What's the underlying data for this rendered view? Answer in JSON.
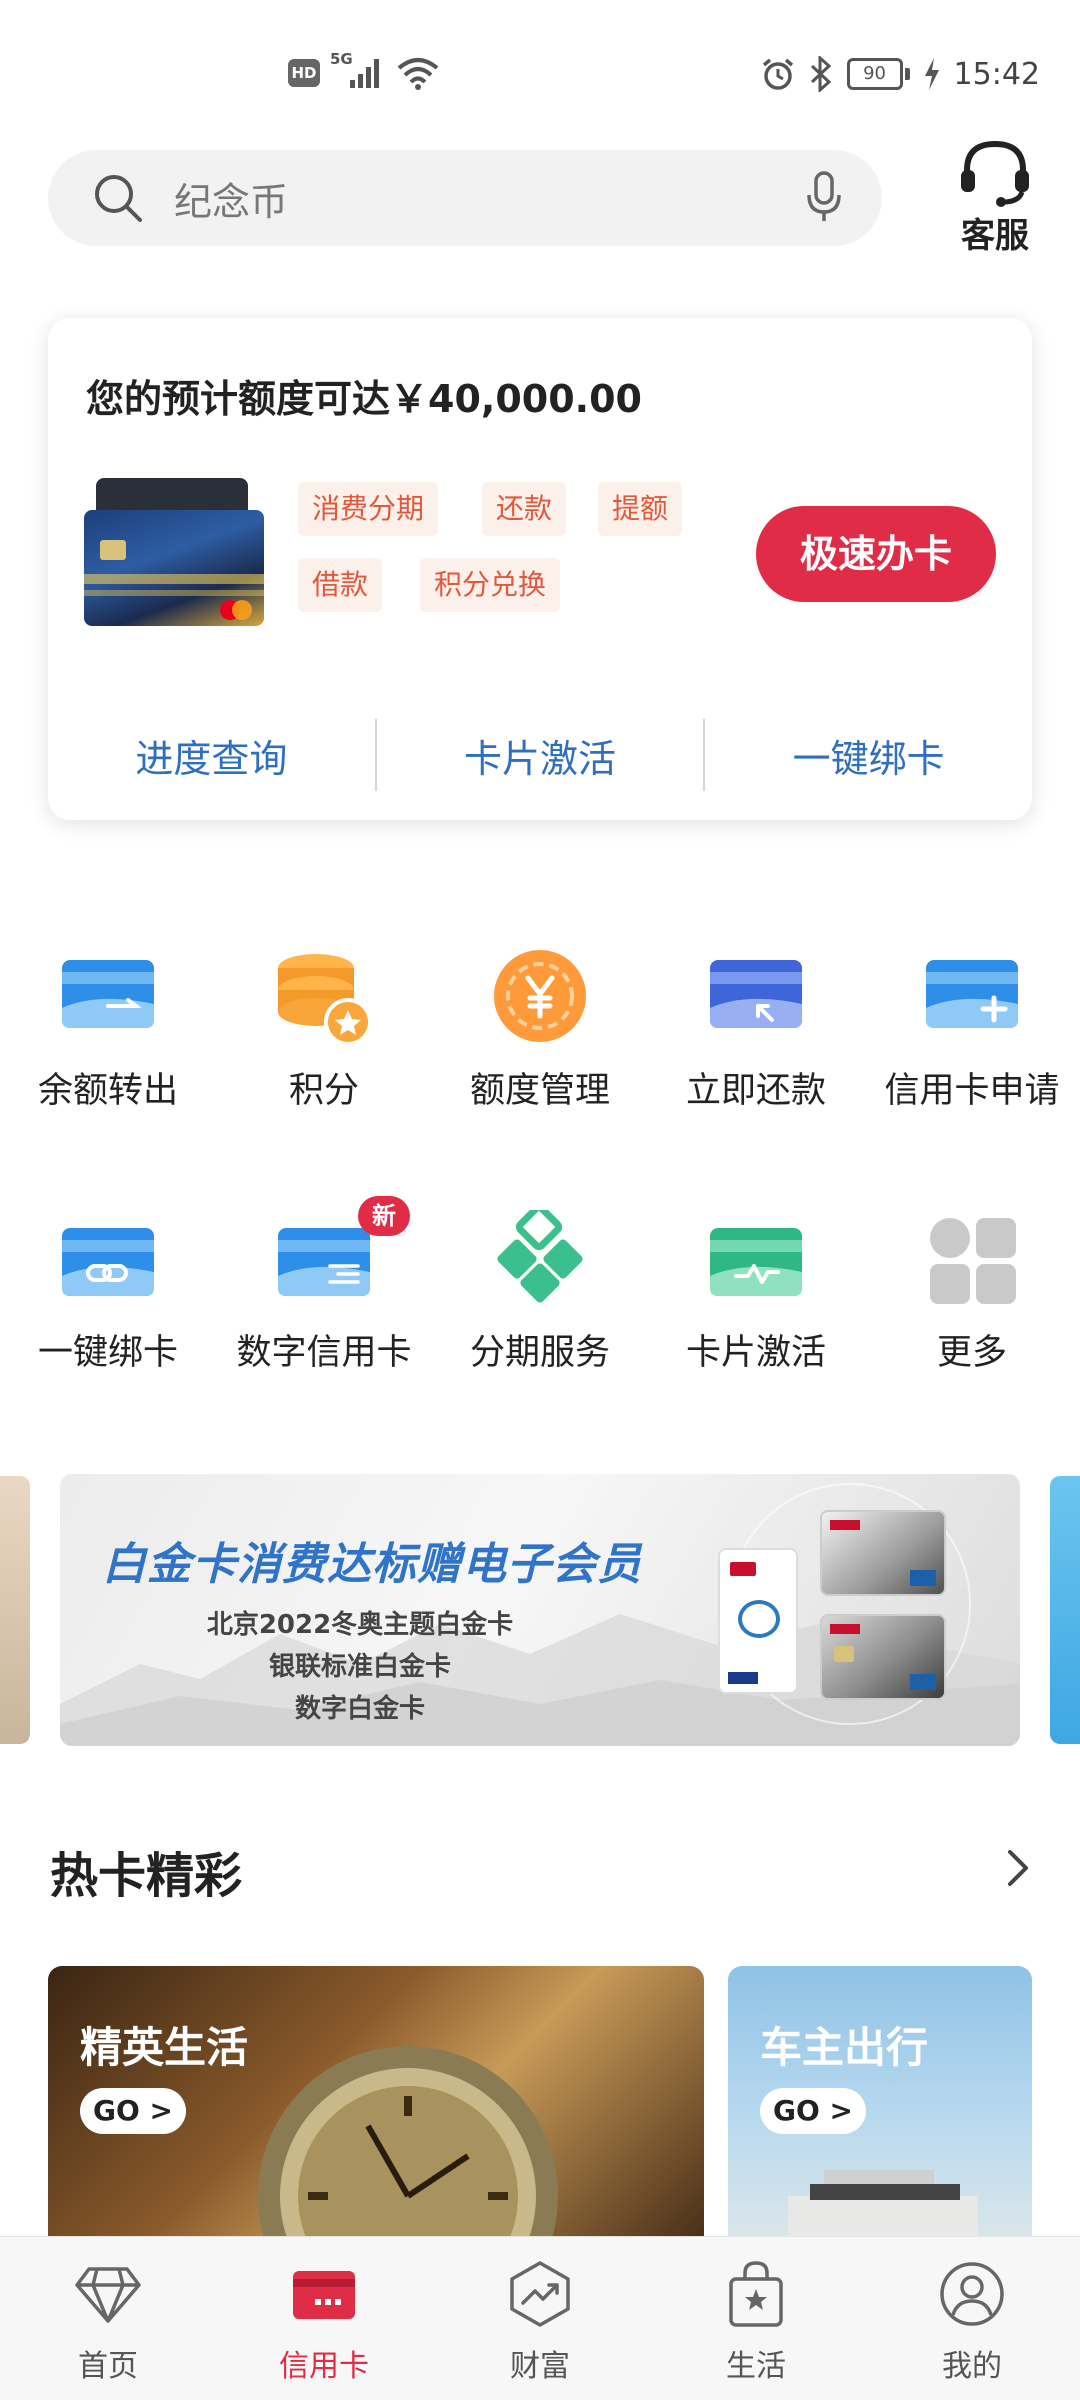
{
  "status_bar": {
    "network_hd": "HD",
    "network_type": "5G",
    "battery": "90",
    "time": "15:42"
  },
  "search": {
    "placeholder": "纪念币"
  },
  "customer_service": {
    "label": "客服"
  },
  "credit_panel": {
    "title": "您的预计额度可达￥40,000.00",
    "tags": [
      "消费分期",
      "还款",
      "提额",
      "借款",
      "积分兑换"
    ],
    "apply_button": "极速办卡",
    "links": [
      "进度查询",
      "卡片激活",
      "一键绑卡"
    ]
  },
  "services_row1": [
    {
      "label": "余额转出",
      "icon": "card-transfer-icon"
    },
    {
      "label": "积分",
      "icon": "points-coins-icon"
    },
    {
      "label": "额度管理",
      "icon": "yuan-coin-icon"
    },
    {
      "label": "立即还款",
      "icon": "card-repay-icon"
    },
    {
      "label": "信用卡申请",
      "icon": "card-add-icon"
    }
  ],
  "services_row2": [
    {
      "label": "一键绑卡",
      "icon": "card-link-icon"
    },
    {
      "label": "数字信用卡",
      "icon": "digital-card-icon",
      "badge": "新"
    },
    {
      "label": "分期服务",
      "icon": "installment-diamonds-icon"
    },
    {
      "label": "卡片激活",
      "icon": "card-activate-icon"
    },
    {
      "label": "更多",
      "icon": "more-grid-icon"
    }
  ],
  "banner": {
    "title": "白金卡消费达标赠电子会员",
    "lines": [
      "北京2022冬奥主题白金卡",
      "银联标准白金卡",
      "数字白金卡"
    ]
  },
  "hot_cards": {
    "title": "热卡精彩",
    "items": [
      {
        "title": "精英生活",
        "go": "GO >"
      },
      {
        "title": "车主出行",
        "go": "GO >"
      }
    ]
  },
  "tab_bar": {
    "active": "信用卡",
    "tabs": [
      {
        "label": "首页",
        "icon": "diamond-icon"
      },
      {
        "label": "信用卡",
        "icon": "credit-card-icon"
      },
      {
        "label": "财富",
        "icon": "wealth-chart-icon"
      },
      {
        "label": "生活",
        "icon": "shopping-bag-icon"
      },
      {
        "label": "我的",
        "icon": "user-profile-icon"
      }
    ]
  },
  "colors": {
    "accent_red": "#e12c47",
    "link_blue": "#2f6fbf",
    "tag_text": "#e2583c",
    "tag_bg": "#fbf0ea"
  }
}
